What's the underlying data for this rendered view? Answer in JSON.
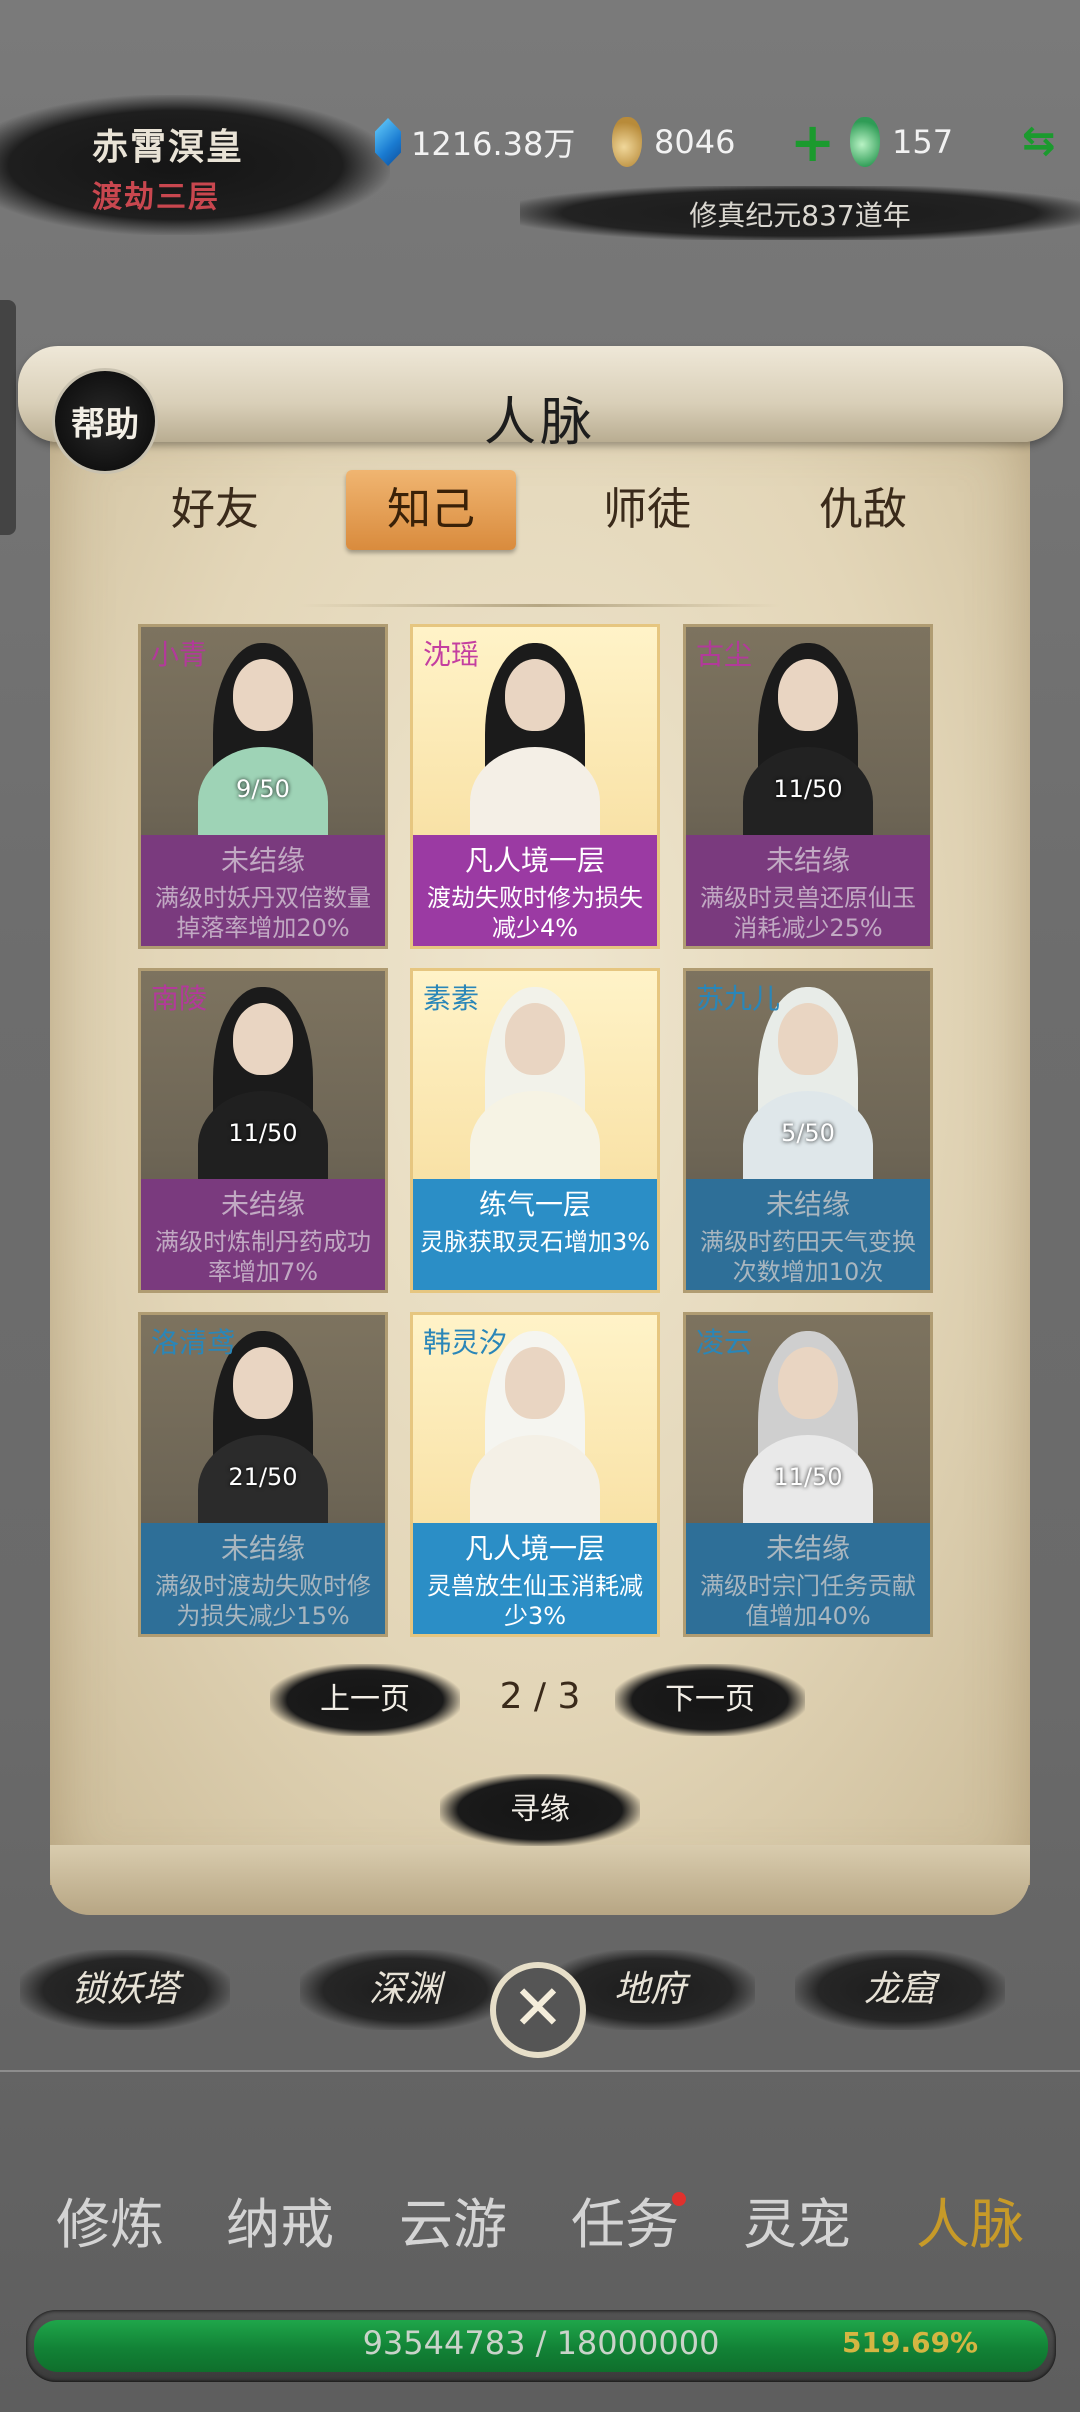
{
  "header": {
    "player_name": "赤霄溟皇",
    "realm": "渡劫三层",
    "spirit_stones": "1216.38万",
    "gourd_count": "8046",
    "jade_count": "157",
    "plus_label": "+",
    "swap_label": "⇆",
    "era": "修真纪元837道年"
  },
  "panel": {
    "help_label": "帮助",
    "title": "人脉",
    "tabs": [
      "好友",
      "知己",
      "师徒",
      "仇敌"
    ],
    "active_tab": "知己",
    "cards": [
      {
        "name": "小青",
        "count": "9/50",
        "status": "未结缘",
        "effect": "满级时妖丹双倍数量掉落率增加20%",
        "style": "dark",
        "band": "purple",
        "name_color": "#b23a9a"
      },
      {
        "name": "沈瑶",
        "count": "",
        "status": "凡人境一层",
        "effect": "渡劫失败时修为损失减少4%",
        "style": "gold",
        "band": "purple",
        "name_color": "#c43fa0"
      },
      {
        "name": "古尘",
        "count": "11/50",
        "status": "未结缘",
        "effect": "满级时灵兽还原仙玉消耗减少25%",
        "style": "dark",
        "band": "purple",
        "name_color": "#b23a9a"
      },
      {
        "name": "南陵",
        "count": "11/50",
        "status": "未结缘",
        "effect": "满级时炼制丹药成功率增加7%",
        "style": "dark",
        "band": "purple",
        "name_color": "#b23a9a"
      },
      {
        "name": "素素",
        "count": "",
        "status": "练气一层",
        "effect": "灵脉获取灵石增加3%",
        "style": "gold",
        "band": "blue",
        "name_color": "#2a86b8"
      },
      {
        "name": "苏九儿",
        "count": "5/50",
        "status": "未结缘",
        "effect": "满级时药田天气变换次数增加10次",
        "style": "dark",
        "band": "blue",
        "name_color": "#2a86b8"
      },
      {
        "name": "洛清鸢",
        "count": "21/50",
        "status": "未结缘",
        "effect": "满级时渡劫失败时修为损失减少15%",
        "style": "dark",
        "band": "blue",
        "name_color": "#2a86b8"
      },
      {
        "name": "韩灵汐",
        "count": "",
        "status": "凡人境一层",
        "effect": "灵兽放生仙玉消耗减少3%",
        "style": "gold",
        "band": "blue",
        "name_color": "#2a86b8"
      },
      {
        "name": "凌云",
        "count": "11/50",
        "status": "未结缘",
        "effect": "满级时宗门任务贡献值增加40%",
        "style": "dark",
        "band": "blue",
        "name_color": "#2a86b8"
      }
    ],
    "prev_label": "上一页",
    "page": "2 / 3",
    "next_label": "下一页",
    "seek_label": "寻缘"
  },
  "sub_menu": [
    "锁妖塔",
    "深渊",
    "地府",
    "龙窟"
  ],
  "close_label": "✕",
  "bottom_nav": [
    "修炼",
    "纳戒",
    "云游",
    "任务",
    "灵宠",
    "人脉"
  ],
  "bottom_nav_active": "人脉",
  "exp": {
    "text": "93544783 / 18000000",
    "percent_label": "519.69%",
    "fill_fraction": 1.0
  }
}
